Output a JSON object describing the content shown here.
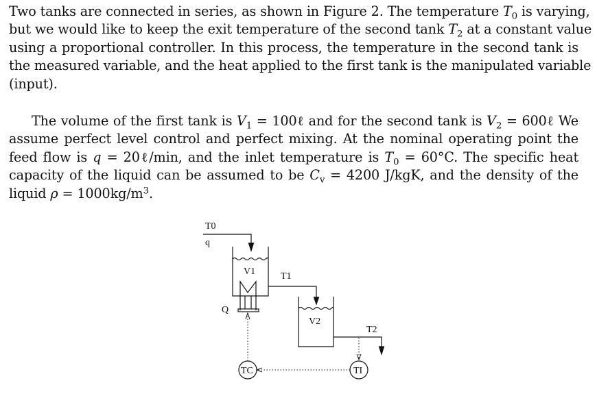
{
  "paragraph1": {
    "lines": [
      [
        "Two tanks are connected in series, as shown in Figure 2. The temperature ",
        "T",
        "0",
        " is varying,"
      ],
      [
        "but we would like to keep the exit temperature of the second tank ",
        "T",
        "2",
        " at a constant value"
      ],
      [
        "using a proportional controller. In this process, the temperature in the second tank is"
      ],
      [
        "the measured variable, and the heat applied to the first tank is the manipulated variable"
      ],
      [
        "(input)."
      ]
    ]
  },
  "paragraph2": {
    "l1a": "The volume of the first tank is ",
    "V1": "V",
    "V1sub": "1",
    "l1b": " = 100ℓ and for the second tank is ",
    "V2": "V",
    "V2sub": "2",
    "l1c": " = 600ℓ We",
    "l2": "assume perfect level control and perfect mixing. At the nominal operating point the",
    "l3a": "feed flow is ",
    "q": "q",
    "l3b": " = 20ℓ/min, and the inlet temperature is ",
    "T0": "T",
    "T0sub": "0",
    "l3c": " = 60°C. The specific heat",
    "l4a": "capacity of the liquid can be assumed to be ",
    "Cv": "C",
    "Cvsub": "v",
    "l4b": " = 4200 J/kgK, and the density of the",
    "l5a": "liquid ",
    "rho": "ρ",
    "l5b": " = 1000kg/m",
    "l5sup": "3",
    "l5c": "."
  },
  "figure": {
    "labels": {
      "inlet_temp": "T0",
      "inlet_flow": "q",
      "tank1_volume": "V1",
      "heat": "Q",
      "tank1_out_temp": "T1",
      "tank2_volume": "V2",
      "tank2_out_temp": "T2",
      "controller": "TC",
      "indicator": "TI"
    }
  }
}
